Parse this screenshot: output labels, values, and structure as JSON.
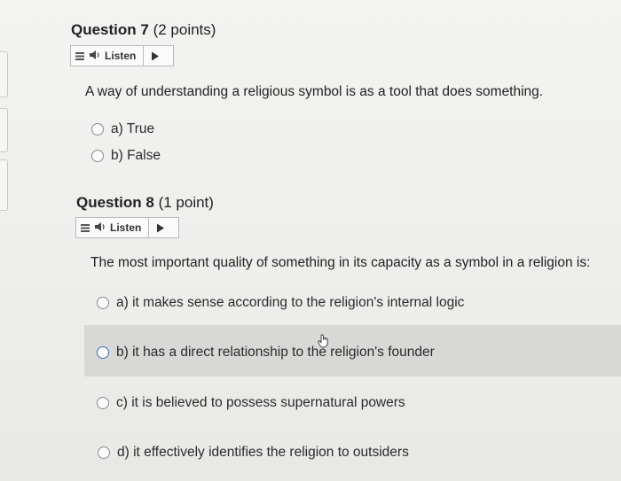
{
  "questions": [
    {
      "heading": "Question 7",
      "points": " (2 points)",
      "listen_label": "Listen",
      "prompt": "A way of understanding a religious symbol is as a tool that does something.",
      "options": [
        "a) True",
        "b) False"
      ]
    },
    {
      "heading": "Question 8",
      "points": " (1 point)",
      "listen_label": "Listen",
      "prompt": "The most important quality of something in its capacity as a symbol in a religion is:",
      "options": [
        "a)  it makes sense according to the religion's internal logic",
        "b)  it has a direct relationship to the religion's founder",
        "c)  it is believed to possess supernatural powers",
        "d)  it effectively identifies the religion to outsiders"
      ]
    }
  ],
  "icons": {
    "menu": "hamburger-icon",
    "speaker": "speaker-icon",
    "play": "play-icon",
    "cursor": "hand-pointer-icon"
  },
  "colors": {
    "hover_row": "#d8d8d6",
    "radio_border": "#8a8a8a",
    "radio_active": "#3b6fb6"
  }
}
